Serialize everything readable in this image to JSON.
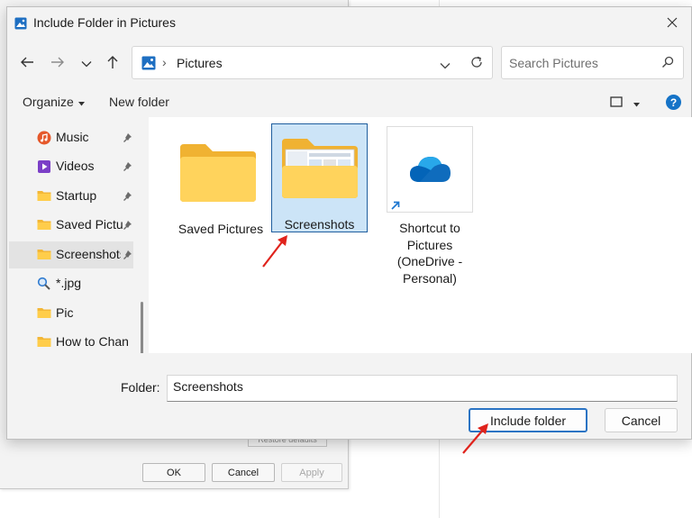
{
  "background_window": {
    "restore_label": "Restore defaults",
    "ok_label": "OK",
    "cancel_label": "Cancel",
    "apply_label": "Apply"
  },
  "dialog": {
    "title": "Include Folder in Pictures",
    "address": {
      "location": "Pictures"
    },
    "search": {
      "placeholder": "Search Pictures"
    },
    "toolbar": {
      "organize_label": "Organize",
      "new_folder_label": "New folder",
      "help_label": "?"
    },
    "nav_items": [
      {
        "label": "Music",
        "icon": "music-icon",
        "pinned": true
      },
      {
        "label": "Videos",
        "icon": "video-icon",
        "pinned": true
      },
      {
        "label": "Startup",
        "icon": "folder-icon",
        "pinned": true
      },
      {
        "label": "Saved Pictu",
        "icon": "folder-icon",
        "pinned": true
      },
      {
        "label": "Screenshots",
        "icon": "folder-icon",
        "pinned": true,
        "selected": true
      },
      {
        "label": "*.jpg",
        "icon": "search-icon",
        "pinned": false
      },
      {
        "label": "Pic",
        "icon": "folder-icon",
        "pinned": false
      },
      {
        "label": "How to Chang",
        "icon": "folder-icon",
        "pinned": false
      }
    ],
    "files": [
      {
        "label": "Saved Pictures",
        "type": "folder"
      },
      {
        "label": "Screenshots",
        "type": "folder",
        "selected": true
      },
      {
        "label_lines": [
          "Shortcut to",
          "Pictures",
          "(OneDrive -",
          "Personal)"
        ],
        "type": "shortcut"
      }
    ],
    "folder_field": {
      "label": "Folder:",
      "value": "Screenshots"
    },
    "buttons": {
      "include_label": "Include folder",
      "cancel_label": "Cancel"
    }
  },
  "colors": {
    "accent": "#2b74c4",
    "selection": "#cce4f7",
    "annotation_arrow": "#e0231c",
    "folder_yellow": "#ffc83d"
  }
}
